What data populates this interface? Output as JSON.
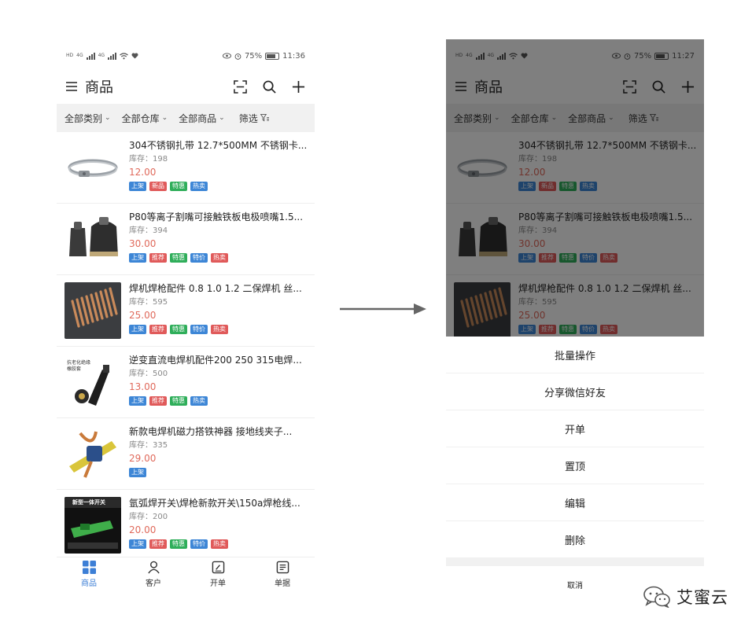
{
  "status_left": {
    "time": "11:36",
    "battery": "75%",
    "battery_level": 0.75
  },
  "status_right": {
    "time": "11:27",
    "battery": "75%",
    "battery_level": 0.75
  },
  "network_labels": {
    "hd": "HD",
    "g": "4G"
  },
  "appbar": {
    "title": "商品"
  },
  "filters": [
    "全部类别",
    "全部仓库",
    "全部商品",
    "筛选"
  ],
  "products": [
    {
      "name": "304不锈钢扎带 12.7*500MM 不锈钢卡...",
      "stock_label": "库存",
      "stock": "198",
      "price": "12.00",
      "tags": [
        {
          "label": "上架",
          "color": "#3d86d6"
        },
        {
          "label": "新品",
          "color": "#e05a5a"
        },
        {
          "label": "特惠",
          "color": "#2fae5a"
        },
        {
          "label": "热卖",
          "color": "#3d86d6"
        }
      ]
    },
    {
      "name": "P80等离子割嘴可接触铁板电极喷嘴1.5...",
      "stock_label": "库存",
      "stock": "394",
      "price": "30.00",
      "tags": [
        {
          "label": "上架",
          "color": "#3d86d6"
        },
        {
          "label": "推荐",
          "color": "#e05a5a"
        },
        {
          "label": "特惠",
          "color": "#2fae5a"
        },
        {
          "label": "特价",
          "color": "#3d86d6"
        },
        {
          "label": "热卖",
          "color": "#e05a5a"
        }
      ]
    },
    {
      "name": "焊机焊枪配件 0.8 1.0 1.2 二保焊机 丝...",
      "stock_label": "库存",
      "stock": "595",
      "price": "25.00",
      "tags": [
        {
          "label": "上架",
          "color": "#3d86d6"
        },
        {
          "label": "推荐",
          "color": "#e05a5a"
        },
        {
          "label": "特惠",
          "color": "#2fae5a"
        },
        {
          "label": "特价",
          "color": "#3d86d6"
        },
        {
          "label": "热卖",
          "color": "#e05a5a"
        }
      ]
    },
    {
      "name": "逆变直流电焊机配件200 250 315电焊...",
      "stock_label": "库存",
      "stock": "500",
      "price": "13.00",
      "tags": [
        {
          "label": "上架",
          "color": "#3d86d6"
        },
        {
          "label": "推荐",
          "color": "#e05a5a"
        },
        {
          "label": "特惠",
          "color": "#2fae5a"
        },
        {
          "label": "热卖",
          "color": "#3d86d6"
        }
      ]
    },
    {
      "name": "新款电焊机磁力搭铁神器 接地线夹子...",
      "stock_label": "库存",
      "stock": "335",
      "price": "29.00",
      "tags": [
        {
          "label": "上架",
          "color": "#3d86d6"
        }
      ]
    },
    {
      "name": "氩弧焊开关\\焊枪新款开关\\150a焊枪线...",
      "stock_label": "库存",
      "stock": "200",
      "price": "20.00",
      "tags": [
        {
          "label": "上架",
          "color": "#3d86d6"
        },
        {
          "label": "推荐",
          "color": "#e05a5a"
        },
        {
          "label": "特惠",
          "color": "#2fae5a"
        },
        {
          "label": "特价",
          "color": "#3d86d6"
        },
        {
          "label": "热卖",
          "color": "#e05a5a"
        }
      ]
    }
  ],
  "thumb_texts": {
    "p4_line1": "抗老化绝缘",
    "p4_line2": "橡胶套",
    "p6_title": "新型一体开关"
  },
  "tabs": [
    {
      "label": "商品",
      "icon": "grid-icon",
      "active": true
    },
    {
      "label": "客户",
      "icon": "person-icon",
      "active": false
    },
    {
      "label": "开单",
      "icon": "edit-doc-icon",
      "active": false
    },
    {
      "label": "单据",
      "icon": "list-doc-icon",
      "active": false
    }
  ],
  "action_sheet": {
    "items": [
      "批量操作",
      "分享微信好友",
      "开单",
      "置顶",
      "编辑",
      "删除"
    ],
    "cancel": "取消"
  },
  "watermark": {
    "text": "艾蜜云"
  },
  "colors": {
    "accent": "#3d7fd6",
    "price": "#e06a5c",
    "filter_bg": "#f1f1f1"
  }
}
